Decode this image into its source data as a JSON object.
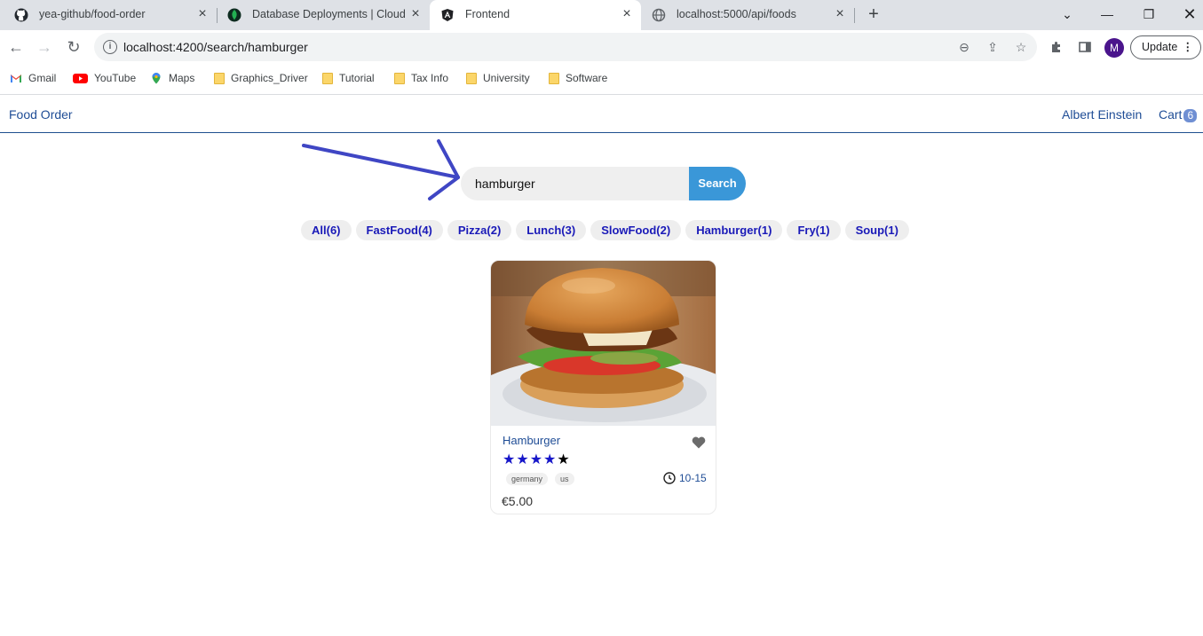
{
  "browser": {
    "tabs": [
      {
        "title": "yea-github/food-order",
        "icon": "github-icon"
      },
      {
        "title": "Database Deployments | Cloud: M",
        "icon": "mongodb-leaf-icon"
      },
      {
        "title": "Frontend",
        "icon": "angular-icon"
      },
      {
        "title": "localhost:5000/api/foods",
        "icon": "globe-icon"
      }
    ],
    "active_tab": 2,
    "url": "localhost:4200/search/hamburger",
    "update_label": "Update",
    "profile_initial": "M",
    "bookmarks": [
      {
        "label": "Gmail",
        "icon": "gmail-icon"
      },
      {
        "label": "YouTube",
        "icon": "youtube-icon"
      },
      {
        "label": "Maps",
        "icon": "maps-icon"
      },
      {
        "label": "Graphics_Driver",
        "icon": "folder-icon"
      },
      {
        "label": "Tutorial",
        "icon": "folder-icon"
      },
      {
        "label": "Tax Info",
        "icon": "folder-icon"
      },
      {
        "label": "University",
        "icon": "folder-icon"
      },
      {
        "label": "Software",
        "icon": "folder-icon"
      }
    ]
  },
  "header": {
    "brand": "Food Order",
    "user": "Albert Einstein",
    "cart_label": "Cart",
    "cart_count": "6"
  },
  "search": {
    "value": "hamburger",
    "button": "Search"
  },
  "tags": [
    "All(6)",
    "FastFood(4)",
    "Pizza(2)",
    "Lunch(3)",
    "SlowFood(2)",
    "Hamburger(1)",
    "Fry(1)",
    "Soup(1)"
  ],
  "foods": [
    {
      "name": "Hamburger",
      "stars": 5,
      "origins": [
        "germany",
        "us"
      ],
      "cook_time": "10-15",
      "price": "€5.00"
    }
  ],
  "colors": {
    "link": "#1f4d96",
    "search_button": "#3a97d8",
    "tag_text": "#1a1ab8",
    "arrow": "#3f46c4"
  }
}
